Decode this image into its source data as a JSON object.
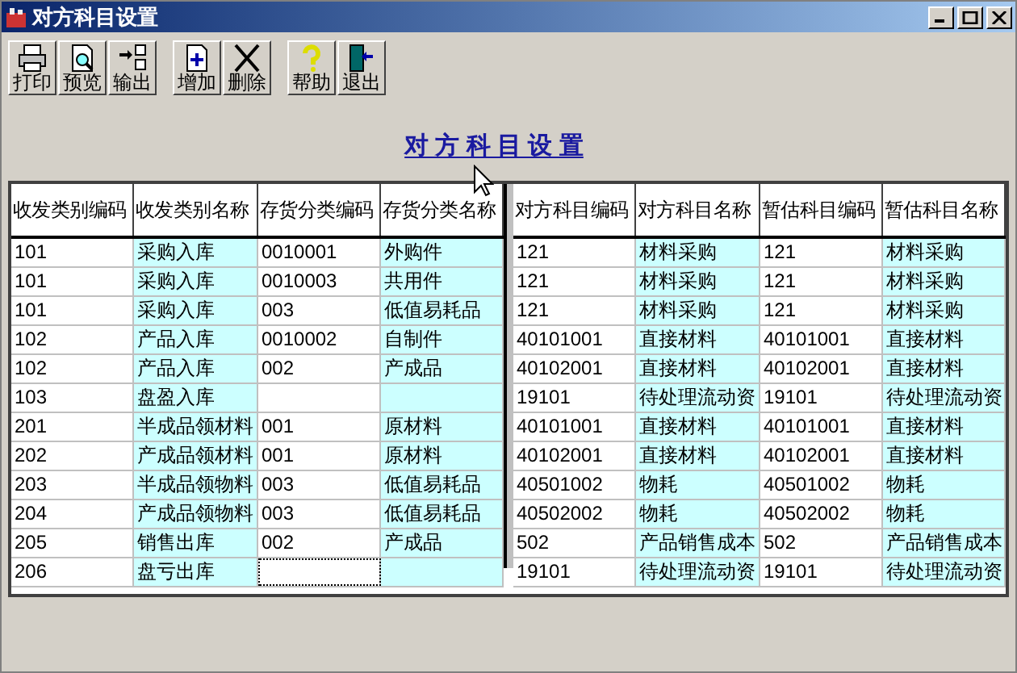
{
  "window": {
    "title": "对方科目设置"
  },
  "toolbar": {
    "groups": [
      [
        "打印",
        "预览",
        "输出"
      ],
      [
        "增加",
        "删除"
      ],
      [
        "帮助",
        "退出"
      ]
    ]
  },
  "heading": "对 方 科 目 设 置",
  "table": {
    "columns": [
      "收发类别编码",
      "收发类别名称",
      "存货分类编码",
      "存货分类名称",
      "对方科目编码",
      "对方科目名称",
      "暂估科目编码",
      "暂估科目名称"
    ],
    "rows": [
      {
        "cells": [
          {
            "text": "101",
            "focused": false
          },
          {
            "text": "采购入库",
            "focused": false
          },
          {
            "text": "0010001",
            "focused": false
          },
          {
            "text": "外购件",
            "focused": false
          },
          {
            "text": "121",
            "focused": false
          },
          {
            "text": "材料采购",
            "focused": false
          },
          {
            "text": "121",
            "focused": false
          },
          {
            "text": "材料采购",
            "focused": false
          }
        ]
      },
      {
        "cells": [
          {
            "text": "101",
            "focused": false
          },
          {
            "text": "采购入库",
            "focused": false
          },
          {
            "text": "0010003",
            "focused": false
          },
          {
            "text": "共用件",
            "focused": false
          },
          {
            "text": "121",
            "focused": false
          },
          {
            "text": "材料采购",
            "focused": false
          },
          {
            "text": "121",
            "focused": false
          },
          {
            "text": "材料采购",
            "focused": false
          }
        ]
      },
      {
        "cells": [
          {
            "text": "101",
            "focused": false
          },
          {
            "text": "采购入库",
            "focused": false
          },
          {
            "text": "003",
            "focused": false
          },
          {
            "text": "低值易耗品",
            "focused": false
          },
          {
            "text": "121",
            "focused": false
          },
          {
            "text": "材料采购",
            "focused": false
          },
          {
            "text": "121",
            "focused": false
          },
          {
            "text": "材料采购",
            "focused": false
          }
        ]
      },
      {
        "cells": [
          {
            "text": "102",
            "focused": false
          },
          {
            "text": "产品入库",
            "focused": false
          },
          {
            "text": "0010002",
            "focused": false
          },
          {
            "text": "自制件",
            "focused": false
          },
          {
            "text": "40101001",
            "focused": false
          },
          {
            "text": "直接材料",
            "focused": false
          },
          {
            "text": "40101001",
            "focused": false
          },
          {
            "text": "直接材料",
            "focused": false
          }
        ]
      },
      {
        "cells": [
          {
            "text": "102",
            "focused": false
          },
          {
            "text": "产品入库",
            "focused": false
          },
          {
            "text": "002",
            "focused": false
          },
          {
            "text": "产成品",
            "focused": false
          },
          {
            "text": "40102001",
            "focused": false
          },
          {
            "text": "直接材料",
            "focused": false
          },
          {
            "text": "40102001",
            "focused": false
          },
          {
            "text": "直接材料",
            "focused": false
          }
        ]
      },
      {
        "cells": [
          {
            "text": "103",
            "focused": false
          },
          {
            "text": "盘盈入库",
            "focused": false
          },
          {
            "focused": false
          },
          {
            "focused": false
          },
          {
            "text": "19101",
            "focused": false
          },
          {
            "text": "待处理流动资",
            "focused": false
          },
          {
            "text": "19101",
            "focused": false
          },
          {
            "text": "待处理流动资",
            "focused": false
          }
        ]
      },
      {
        "cells": [
          {
            "text": "201",
            "focused": false
          },
          {
            "text": "半成品领材料",
            "focused": false
          },
          {
            "text": "001",
            "focused": false
          },
          {
            "text": "原材料",
            "focused": false
          },
          {
            "text": "40101001",
            "focused": false
          },
          {
            "text": "直接材料",
            "focused": false
          },
          {
            "text": "40101001",
            "focused": false
          },
          {
            "text": "直接材料",
            "focused": false
          }
        ]
      },
      {
        "cells": [
          {
            "text": "202",
            "focused": false
          },
          {
            "text": "产成品领材料",
            "focused": false
          },
          {
            "text": "001",
            "focused": false
          },
          {
            "text": "原材料",
            "focused": false
          },
          {
            "text": "40102001",
            "focused": false
          },
          {
            "text": "直接材料",
            "focused": false
          },
          {
            "text": "40102001",
            "focused": false
          },
          {
            "text": "直接材料",
            "focused": false
          }
        ]
      },
      {
        "cells": [
          {
            "text": "203",
            "focused": false
          },
          {
            "text": "半成品领物料",
            "focused": false
          },
          {
            "text": "003",
            "focused": false
          },
          {
            "text": "低值易耗品",
            "focused": false
          },
          {
            "text": "40501002",
            "focused": false
          },
          {
            "text": "物耗",
            "focused": false
          },
          {
            "text": "40501002",
            "focused": false
          },
          {
            "text": "物耗",
            "focused": false
          }
        ]
      },
      {
        "cells": [
          {
            "text": "204",
            "focused": false
          },
          {
            "text": "产成品领物料",
            "focused": false
          },
          {
            "text": "003",
            "focused": false
          },
          {
            "text": "低值易耗品",
            "focused": false
          },
          {
            "text": "40502002",
            "focused": false
          },
          {
            "text": "物耗",
            "focused": false
          },
          {
            "text": "40502002",
            "focused": false
          },
          {
            "text": "物耗",
            "focused": false
          }
        ]
      },
      {
        "cells": [
          {
            "text": "205",
            "focused": false
          },
          {
            "text": "销售出库",
            "focused": false
          },
          {
            "text": "002",
            "focused": false
          },
          {
            "text": "产成品",
            "focused": false
          },
          {
            "text": "502",
            "focused": false
          },
          {
            "text": "产品销售成本",
            "focused": false
          },
          {
            "text": "502",
            "focused": false
          },
          {
            "text": "产品销售成本",
            "focused": false
          }
        ]
      },
      {
        "cells": [
          {
            "text": "206",
            "focused": false
          },
          {
            "text": "盘亏出库",
            "focused": false
          },
          {
            "focused": true
          },
          {
            "focused": false
          },
          {
            "text": "19101",
            "focused": false
          },
          {
            "text": "待处理流动资",
            "focused": false
          },
          {
            "text": "19101",
            "focused": false
          },
          {
            "text": "待处理流动资",
            "focused": false
          }
        ]
      }
    ]
  }
}
